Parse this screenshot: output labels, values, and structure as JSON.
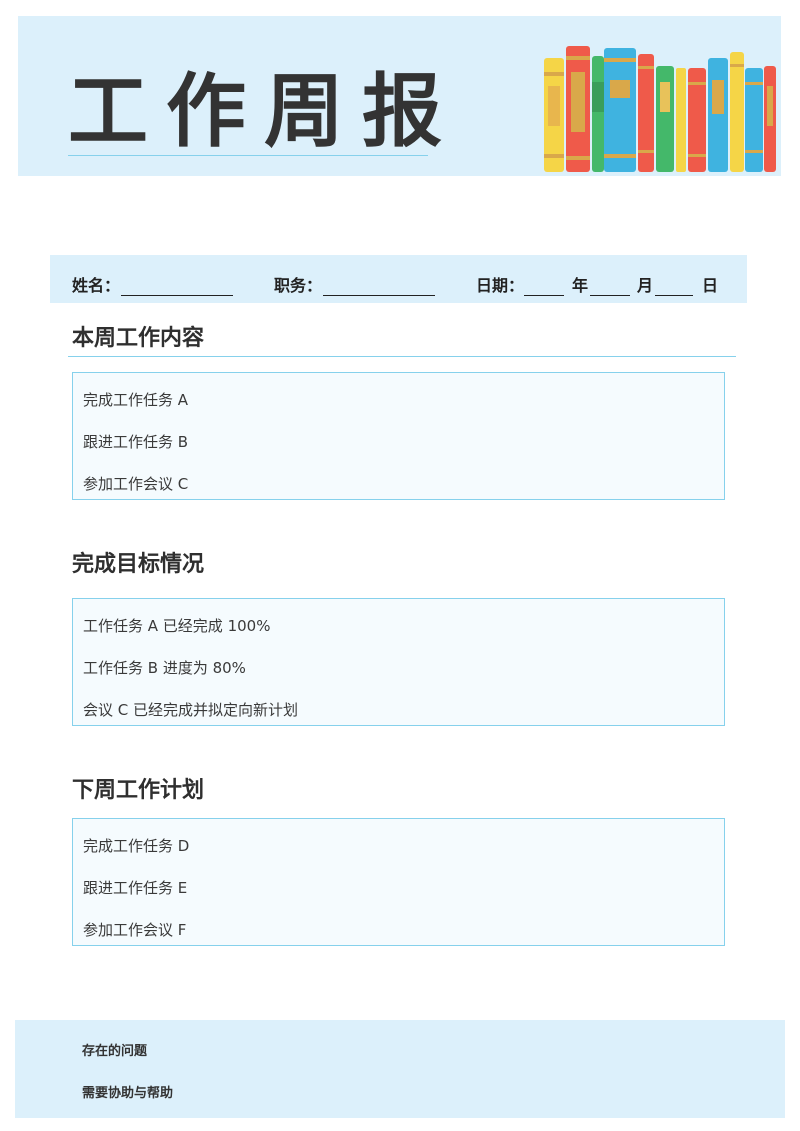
{
  "header": {
    "title": "工作周报",
    "title_chars": [
      "工",
      "作",
      "周",
      "报"
    ]
  },
  "info": {
    "name_label": "姓名：",
    "position_label": "职务：",
    "date_label": "日期：",
    "year_label": "年",
    "month_label": "月",
    "day_label": "日"
  },
  "sections": [
    {
      "title": "本周工作内容",
      "items": [
        "完成工作任务 A",
        "跟进工作任务 B",
        "参加工作会议 C"
      ]
    },
    {
      "title": "完成目标情况",
      "items": [
        "工作任务 A 已经完成 100%",
        "工作任务 B 进度为 80%",
        "会议 C 已经完成并拟定向新计划"
      ]
    },
    {
      "title": "下周工作计划",
      "items": [
        "完成工作任务 D",
        "跟进工作任务 E",
        "参加工作会议 F"
      ]
    }
  ],
  "footer": {
    "problems_label": "存在的问题",
    "help_label": "需要协助与帮助"
  },
  "colors": {
    "band": "#dcf0fb",
    "accent_line": "#86d1ec",
    "text": "#2f2f2f"
  },
  "icons": [
    "books-illustration"
  ]
}
